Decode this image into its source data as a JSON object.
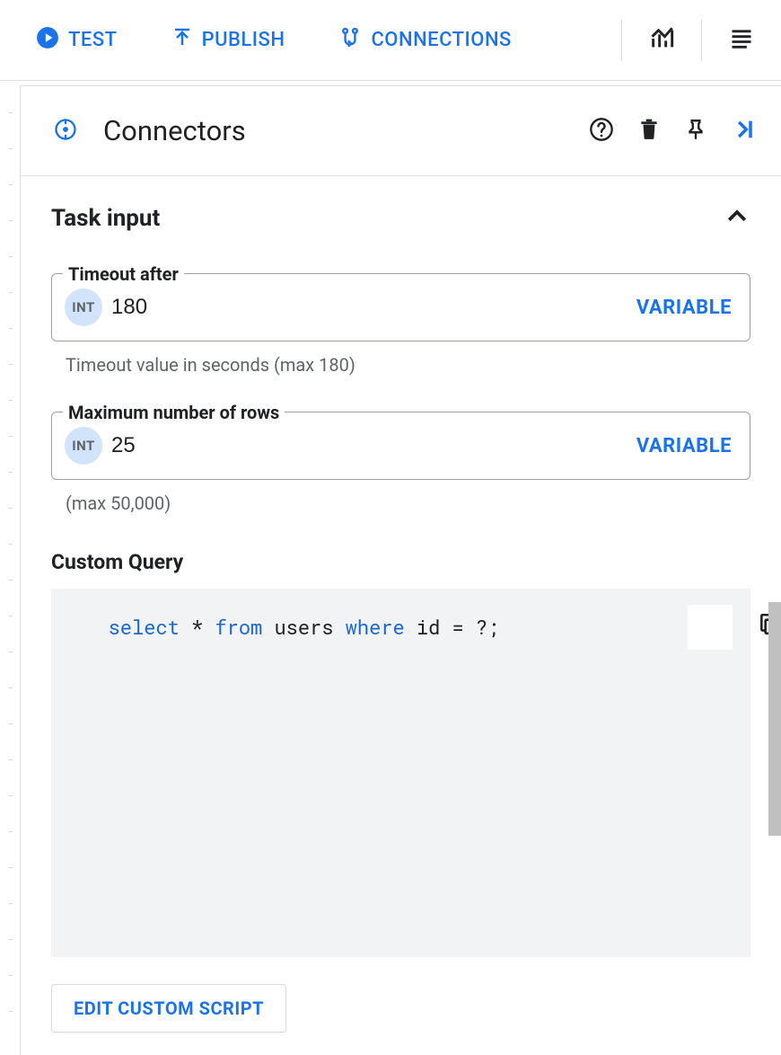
{
  "toolbar": {
    "test": "TEST",
    "publish": "PUBLISH",
    "connections": "CONNECTIONS"
  },
  "panel": {
    "title": "Connectors"
  },
  "section": {
    "title": "Task input"
  },
  "fields": {
    "timeout": {
      "label": "Timeout after",
      "type": "INT",
      "value": "180",
      "action": "VARIABLE",
      "helper": "Timeout value in seconds (max 180)"
    },
    "maxrows": {
      "label": "Maximum number of rows",
      "type": "INT",
      "value": "25",
      "action": "VARIABLE",
      "helper": "(max 50,000)"
    }
  },
  "query": {
    "label": "Custom Query",
    "tokens": {
      "t1": "select",
      "t2": " * ",
      "t3": "from",
      "t4": " users ",
      "t5": "where",
      "t6": " id = ?;"
    }
  },
  "buttons": {
    "edit_script": "EDIT CUSTOM SCRIPT"
  }
}
